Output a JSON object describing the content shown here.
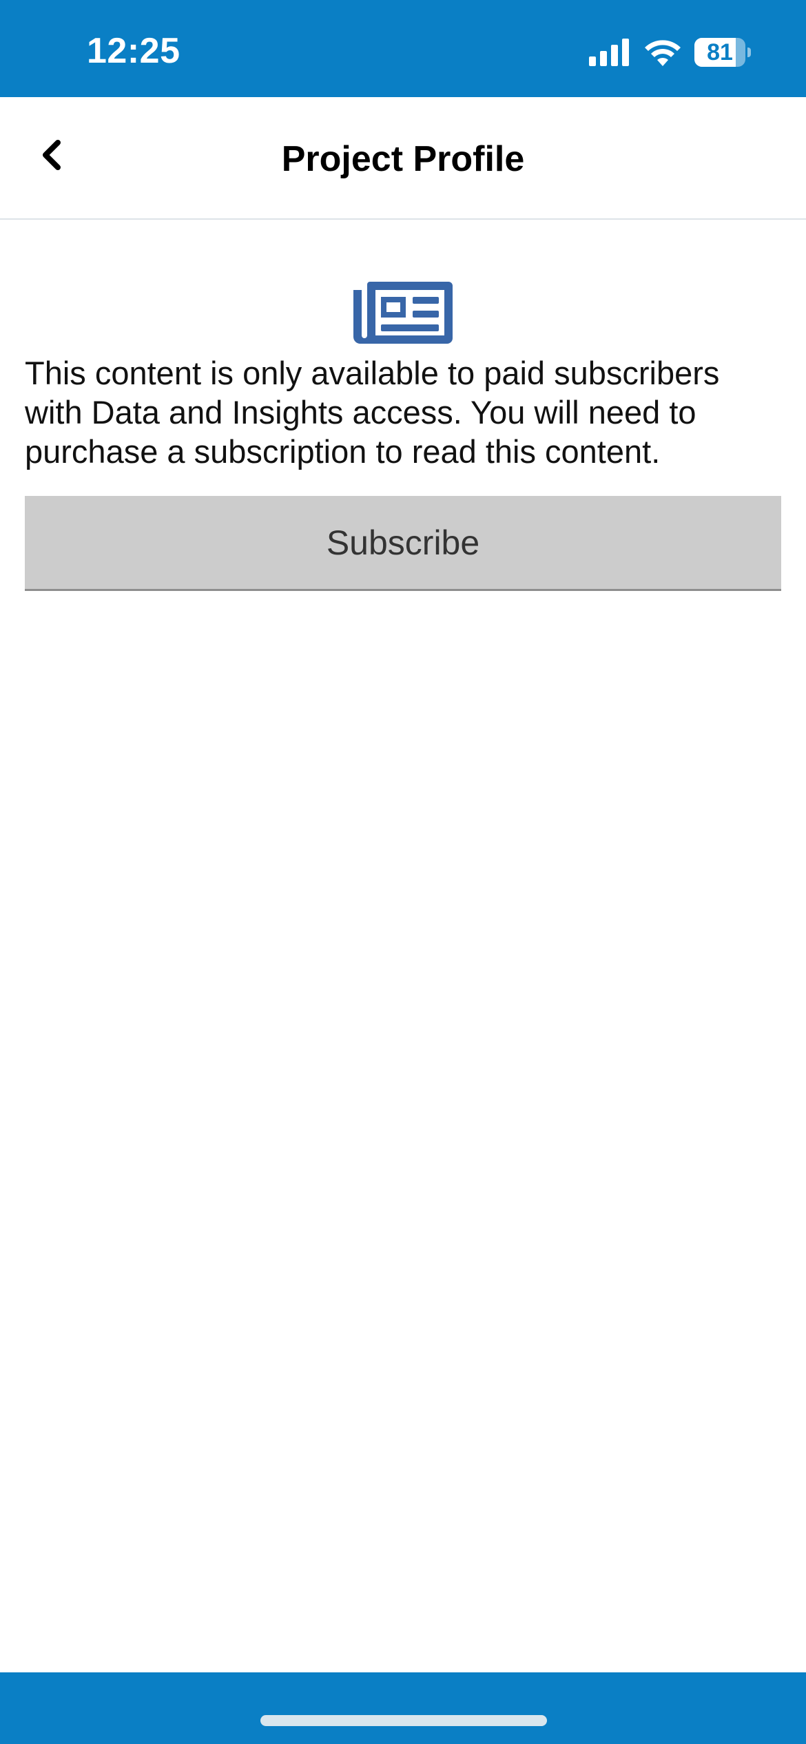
{
  "status_bar": {
    "time": "12:25",
    "battery_level": "81",
    "battery_percent": 81,
    "icons": [
      "signal-icon",
      "wifi-icon",
      "battery-icon"
    ]
  },
  "header": {
    "title": "Project Profile",
    "back_icon": "chevron-left-icon"
  },
  "paywall": {
    "icon": "newspaper-icon",
    "message": "This content is only available to paid subscribers with Data and Insights access. You will need to purchase a subscription to read this content.",
    "subscribe_label": "Subscribe"
  },
  "colors": {
    "brand_blue": "#0a7fc5",
    "icon_blue": "#3866a8",
    "button_gray": "#cccccc"
  }
}
